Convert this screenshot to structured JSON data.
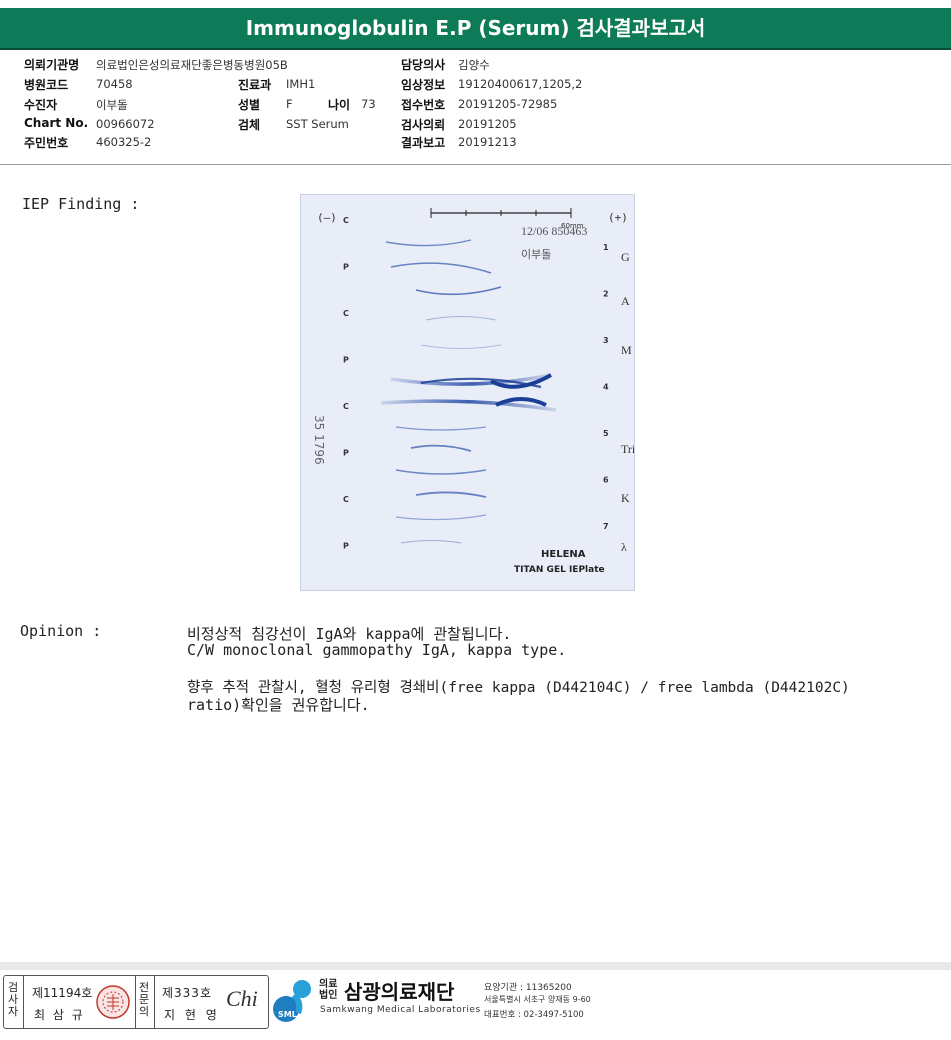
{
  "report_title": "Immunoglobulin E.P (Serum) 검사결과보고서",
  "info": {
    "institution_label": "의뢰기관명",
    "institution": "의료법인은성의료재단좋은병동병원05B",
    "hospital_code_label": "병원코드",
    "hospital_code": "70458",
    "patient_label": "수진자",
    "patient": "이부돌",
    "chart_label": "Chart No.",
    "chart_no": "00966072",
    "resident_label": "주민번호",
    "resident_no": "460325-2",
    "dept_label": "진료과",
    "dept": "IMH1",
    "sex_label": "성별",
    "sex": "F",
    "age_label": "나이",
    "age": "73",
    "specimen_label": "검체",
    "specimen": "SST Serum",
    "doctor_label": "담당의사",
    "doctor": "김양수",
    "clinical_label": "임상정보",
    "clinical": "19120400617,1205,2",
    "receipt_label": "접수번호",
    "receipt": "20191205-72985",
    "request_label": "검사의뢰",
    "request": "20191205",
    "result_label": "결과보고",
    "result": "20191213"
  },
  "finding_label": "IEP Finding :",
  "gel": {
    "minus": "(—)",
    "plus": "(+)",
    "scale": "60mm",
    "stamp": "12/06 850463",
    "patient_hand": "이부돌",
    "side_number": "35 1796",
    "left_labels": [
      "C",
      "P",
      "C",
      "P",
      "C",
      "P",
      "C",
      "P"
    ],
    "lane_numbers": [
      "1",
      "2",
      "3",
      "4",
      "5",
      "6",
      "7"
    ],
    "right_labels": [
      "G",
      "A",
      "M",
      "Tri",
      "K",
      "λ"
    ],
    "brand1": "HELENA",
    "brand2": "TITAN GEL IEPlate",
    "band_color": "#2a4fa8"
  },
  "opinion_label": "Opinion :",
  "opinion": {
    "line1": "비정상적 침강선이 IgA와 kappa에 관찰됩니다.",
    "line2": "C/W monoclonal gammopathy IgA, kappa type.",
    "line3": "향후 추적 관찰시, 혈청 유리형 경쇄비(free kappa (D442104C) / free lambda (D442102C)",
    "line4": "ratio)확인을 권유합니다."
  },
  "footer": {
    "tester_vert": "검사자",
    "tester_no": "제11194호",
    "tester_name": "최 삼 규",
    "specialist_vert": "전문의",
    "specialist_no": "제333호",
    "specialist_name": "지 현 영",
    "signature": "Chi",
    "logo_badge": "SML",
    "org_prefix1": "의료",
    "org_prefix2": "법인",
    "org_name": "삼광의료재단",
    "org_english": "Samkwang Medical Laboratories",
    "line_code": "요양기관 : 11365200",
    "line_address": "서울특별시 서초구 양재동 9-60",
    "line_phone": "대표번호 : 02-3497-5100",
    "accent_color": "#0d7a58"
  }
}
